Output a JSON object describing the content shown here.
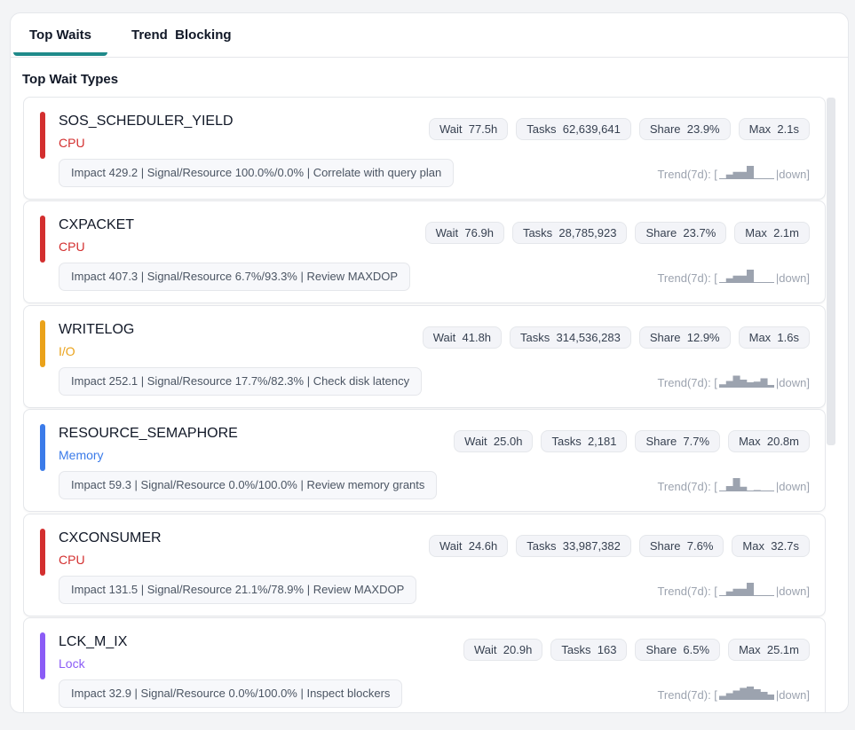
{
  "tabs": [
    {
      "label": "Top Waits",
      "active": true
    },
    {
      "label": "Trend  Blocking",
      "active": false
    }
  ],
  "section_title": "Top Wait Types",
  "labels": {
    "wait": "Wait",
    "tasks": "Tasks",
    "share": "Share",
    "max": "Max",
    "trend_prefix": "Trend(7d): [",
    "trend_close": "|"
  },
  "colors": {
    "CPU": "#d32f2f",
    "I/O": "#eaa21a",
    "Memory": "#3b7be9",
    "Lock": "#8b5cf6",
    "tab_accent": "#1f8a8a",
    "spark": "#9ca3af"
  },
  "waits": [
    {
      "name": "SOS_SCHEDULER_YIELD",
      "category": "CPU",
      "wait": "77.5h",
      "tasks": "62,639,641",
      "share": "23.9%",
      "max": "2.1s",
      "impact": "Impact 429.2 | Signal/Resource 100.0%/0.0% | Correlate with query plan",
      "trend_values": [
        0,
        0.35,
        0.55,
        0.55,
        1,
        0,
        0,
        0
      ],
      "trend_direction": "down]"
    },
    {
      "name": "CXPACKET",
      "category": "CPU",
      "wait": "76.9h",
      "tasks": "28,785,923",
      "share": "23.7%",
      "max": "2.1m",
      "impact": "Impact 407.3 | Signal/Resource 6.7%/93.3% | Review MAXDOP",
      "trend_values": [
        0,
        0.35,
        0.55,
        0.55,
        1,
        0,
        0,
        0
      ],
      "trend_direction": "down]"
    },
    {
      "name": "WRITELOG",
      "category": "I/O",
      "wait": "41.8h",
      "tasks": "314,536,283",
      "share": "12.9%",
      "max": "1.6s",
      "impact": "Impact 252.1 | Signal/Resource 17.7%/82.3% | Check disk latency",
      "trend_values": [
        0.25,
        0.5,
        0.9,
        0.6,
        0.4,
        0.45,
        0.7,
        0.2
      ],
      "trend_direction": "down]"
    },
    {
      "name": "RESOURCE_SEMAPHORE",
      "category": "Memory",
      "wait": "25.0h",
      "tasks": "2,181",
      "share": "7.7%",
      "max": "20.8m",
      "impact": "Impact 59.3 | Signal/Resource 0.0%/100.0% | Review memory grants",
      "trend_values": [
        0,
        0.4,
        1,
        0.35,
        0,
        0.1,
        0,
        0
      ],
      "trend_direction": "down]"
    },
    {
      "name": "CXCONSUMER",
      "category": "CPU",
      "wait": "24.6h",
      "tasks": "33,987,382",
      "share": "7.6%",
      "max": "32.7s",
      "impact": "Impact 131.5 | Signal/Resource 21.1%/78.9% | Review MAXDOP",
      "trend_values": [
        0,
        0.35,
        0.55,
        0.55,
        1,
        0,
        0,
        0
      ],
      "trend_direction": "down]"
    },
    {
      "name": "LCK_M_IX",
      "category": "Lock",
      "wait": "20.9h",
      "tasks": "163",
      "share": "6.5%",
      "max": "25.1m",
      "impact": "Impact 32.9 | Signal/Resource 0.0%/100.0% | Inspect blockers",
      "trend_values": [
        0.3,
        0.5,
        0.7,
        0.9,
        1,
        0.8,
        0.6,
        0.4
      ],
      "trend_direction": "down]"
    }
  ]
}
